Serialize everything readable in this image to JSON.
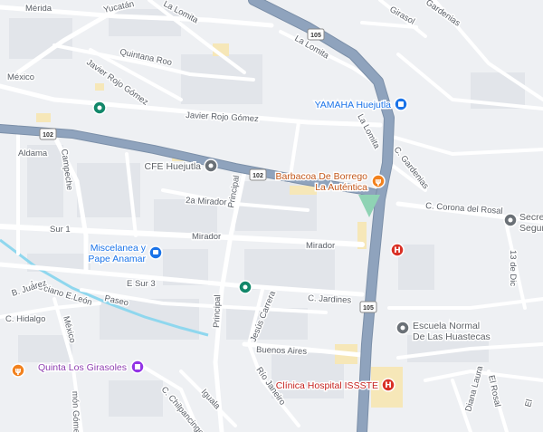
{
  "map": {
    "streets": {
      "merida": "Mérida",
      "yucatan": "Yucatán",
      "la_lomita_1": "La Lomita",
      "la_lomita_2": "La Lomita",
      "la_lomita_3": "La Lomita",
      "girasol": "Girasol",
      "gardenias_top": "Gardenias",
      "quintana_roo": "Quintana Roo",
      "mexico_top": "México",
      "javier_rojo_gomez_1": "Javier Rojo Gómez",
      "javier_rojo_gomez_2": "Javier Rojo Gómez",
      "aldama": "Aldama",
      "campeche": "Campeche",
      "c_gardenias": "C. Gardenias",
      "c_corona_del_rosal": "C. Corona del Rosal",
      "dos_a_mirador": "2a Mirador",
      "principal_1": "Principal",
      "principal_2": "Principal",
      "sur_1": "Sur 1",
      "mirador_1": "Mirador",
      "mirador_2": "Mirador",
      "trece_de_dic": "13 de Dic",
      "e_sur_3": "E Sur 3",
      "paseo": "Paseo",
      "c_jardines": "C. Jardines",
      "jesus_carrera": "Jesús Carrera",
      "marciano_e_leon": "Marciano E.León",
      "b_juarez": "B. Juárez",
      "c_hidalgo": "C. Hidalgo",
      "mexico_bottom": "México",
      "buenos_aires": "Buenos Aires",
      "rio_janeiro": "Río Janeiro",
      "c_chilpancingo": "C. Chilpancingo",
      "iguala": "Iguala",
      "ramon_gomez": "món Gómez",
      "diana_laura": "Diana Laura",
      "el_rosal": "El Rosal",
      "el_bottom": "El"
    },
    "shields": {
      "s1": "105",
      "s2": "102",
      "s3": "102",
      "s4": "105"
    },
    "pois": {
      "yamaha": "YAMAHA Huejutla",
      "cfe": "CFE Huejutla",
      "barbacoa_1": "Barbacoa De Borrego",
      "barbacoa_2": "La Auténtica",
      "secret_1": "Secret",
      "secret_2": "Segur",
      "miscelanea_1": "Miscelanea y",
      "miscelanea_2": "Pape Anamar",
      "escuela_1": "Escuela Normal",
      "escuela_2": "De Las Huastecas",
      "quinta": "Quinta Los Girasoles",
      "clinica": "Clínica Hospital ISSSTE"
    },
    "colors": {
      "background": "#eef0f3",
      "minor_road": "#ffffff",
      "highway": "#8fa3bd",
      "highway_edge": "#7b8fa8",
      "river": "#8fd7ee",
      "building_yellow": "#f6e7b8",
      "blue_pin": "#1a73e8",
      "orange_pin": "#f2811d",
      "red_pin": "#d93025",
      "teal_pin": "#12876a",
      "gray_pin": "#6b7177",
      "purple_pin": "#9334e6"
    }
  }
}
